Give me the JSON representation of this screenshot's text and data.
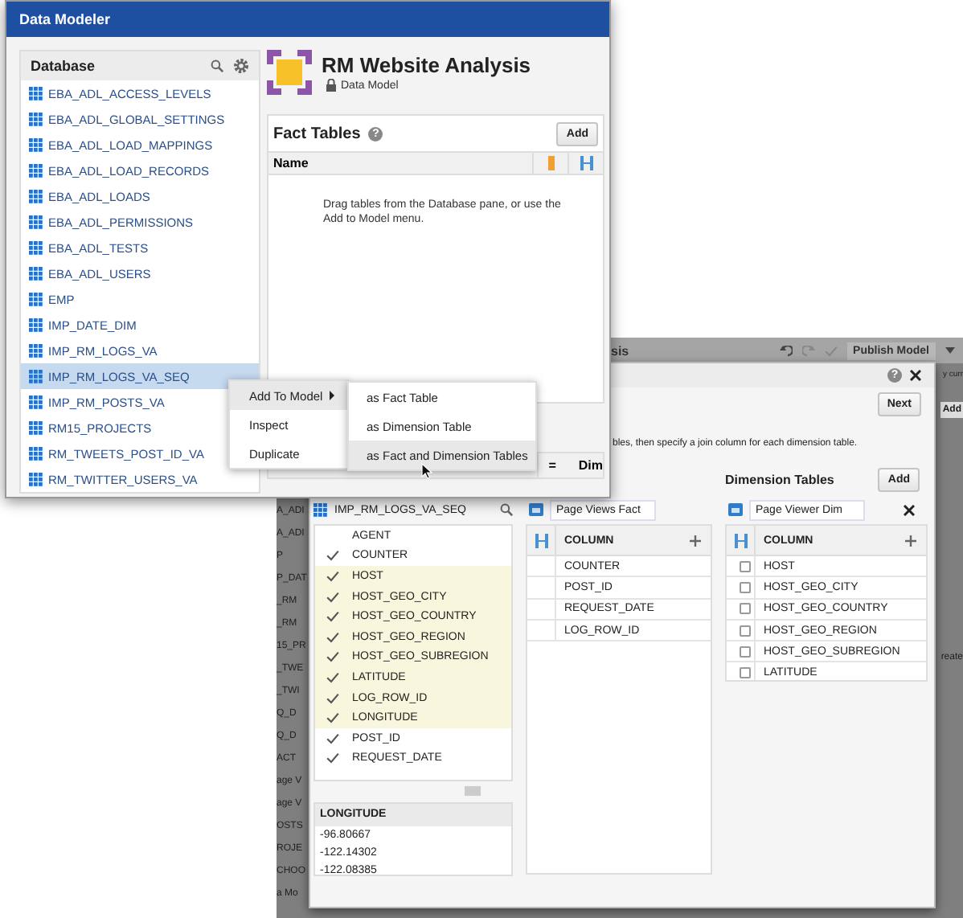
{
  "back_window": {
    "title": "sis",
    "publish": "Publish Model",
    "side_labels": [
      "A_ADI",
      "A_ADI",
      "P",
      "P_DAT",
      "_RM",
      "_RM",
      "15_PR",
      "_TWE",
      "_TWI",
      "Q_D",
      "Q_D",
      "ACT",
      "age V",
      "age V",
      "OSTS",
      "ROJE",
      "CHOO",
      "a Mo"
    ],
    "right_top": "y curr",
    "right_add": "Add",
    "right_bottom": "reate"
  },
  "dialog": {
    "help": "?",
    "next": "Next",
    "instruction": "bles, then specify a join column for each dimension table.",
    "source": {
      "table": "IMP_RM_LOGS_VA_SEQ",
      "columns": [
        {
          "label": "AGENT",
          "checked": false,
          "highlighted": false
        },
        {
          "label": "COUNTER",
          "checked": true,
          "highlighted": false
        },
        {
          "label": "HOST",
          "checked": true,
          "highlighted": true
        },
        {
          "label": "HOST_GEO_CITY",
          "checked": true,
          "highlighted": true
        },
        {
          "label": "HOST_GEO_COUNTRY",
          "checked": true,
          "highlighted": true
        },
        {
          "label": "HOST_GEO_REGION",
          "checked": true,
          "highlighted": true
        },
        {
          "label": "HOST_GEO_SUBREGION",
          "checked": true,
          "highlighted": true
        },
        {
          "label": "LATITUDE",
          "checked": true,
          "highlighted": true
        },
        {
          "label": "LOG_ROW_ID",
          "checked": true,
          "highlighted": true
        },
        {
          "label": "LONGITUDE",
          "checked": true,
          "highlighted": true
        },
        {
          "label": "POST_ID",
          "checked": true,
          "highlighted": false
        },
        {
          "label": "REQUEST_DATE",
          "checked": true,
          "highlighted": false
        }
      ]
    },
    "preview": {
      "column": "LONGITUDE",
      "values": [
        "-96.80667",
        "-122.14302",
        "-122.08385"
      ]
    },
    "fact": {
      "name": "Page Views Fact",
      "header": "COLUMN",
      "rows": [
        "COUNTER",
        "POST_ID",
        "REQUEST_DATE",
        "LOG_ROW_ID"
      ]
    },
    "dimension": {
      "title": "Dimension Tables",
      "add": "Add",
      "name": "Page Viewer Dim",
      "header": "COLUMN",
      "rows": [
        {
          "label": "HOST",
          "checked": false
        },
        {
          "label": "HOST_GEO_CITY",
          "checked": false
        },
        {
          "label": "HOST_GEO_COUNTRY",
          "checked": false
        },
        {
          "label": "HOST_GEO_REGION",
          "checked": false
        },
        {
          "label": "HOST_GEO_SUBREGION",
          "checked": false
        },
        {
          "label": "LATITUDE",
          "checked": false
        }
      ]
    }
  },
  "front_window": {
    "title": "Data Modeler",
    "database": {
      "title": "Database",
      "items": [
        {
          "label": "EBA_ADL_ACCESS_LEVELS",
          "selected": false
        },
        {
          "label": "EBA_ADL_GLOBAL_SETTINGS",
          "selected": false
        },
        {
          "label": "EBA_ADL_LOAD_MAPPINGS",
          "selected": false
        },
        {
          "label": "EBA_ADL_LOAD_RECORDS",
          "selected": false
        },
        {
          "label": "EBA_ADL_LOADS",
          "selected": false
        },
        {
          "label": "EBA_ADL_PERMISSIONS",
          "selected": false
        },
        {
          "label": "EBA_ADL_TESTS",
          "selected": false
        },
        {
          "label": "EBA_ADL_USERS",
          "selected": false
        },
        {
          "label": "EMP",
          "selected": false
        },
        {
          "label": "IMP_DATE_DIM",
          "selected": false
        },
        {
          "label": "IMP_RM_LOGS_VA",
          "selected": false
        },
        {
          "label": "IMP_RM_LOGS_VA_SEQ",
          "selected": true
        },
        {
          "label": "IMP_RM_POSTS_VA",
          "selected": false
        },
        {
          "label": "RM15_PROJECTS",
          "selected": false
        },
        {
          "label": "RM_TWEETS_POST_ID_VA",
          "selected": false
        },
        {
          "label": "RM_TWITTER_USERS_VA",
          "selected": false
        }
      ]
    },
    "model": {
      "title": "RM Website Analysis",
      "subtitle": "Data Model"
    },
    "fact_tables": {
      "title": "Fact Tables",
      "help": "?",
      "add": "Add",
      "column": "Name",
      "empty": "Drag tables from the Database pane, or use the Add to Model menu."
    },
    "dimension_header": {
      "join": "=",
      "label": "Dim"
    }
  },
  "context_menu": {
    "items": [
      {
        "label": "Add To Model",
        "selected": true,
        "submenu": true
      },
      {
        "label": "Inspect",
        "selected": false,
        "submenu": false
      },
      {
        "label": "Duplicate",
        "selected": false,
        "submenu": false
      }
    ]
  },
  "submenu": {
    "items": [
      {
        "label": "as Fact Table",
        "selected": false
      },
      {
        "label": "as Dimension Table",
        "selected": false
      },
      {
        "label": "as Fact and Dimension Tables",
        "selected": true
      }
    ]
  }
}
